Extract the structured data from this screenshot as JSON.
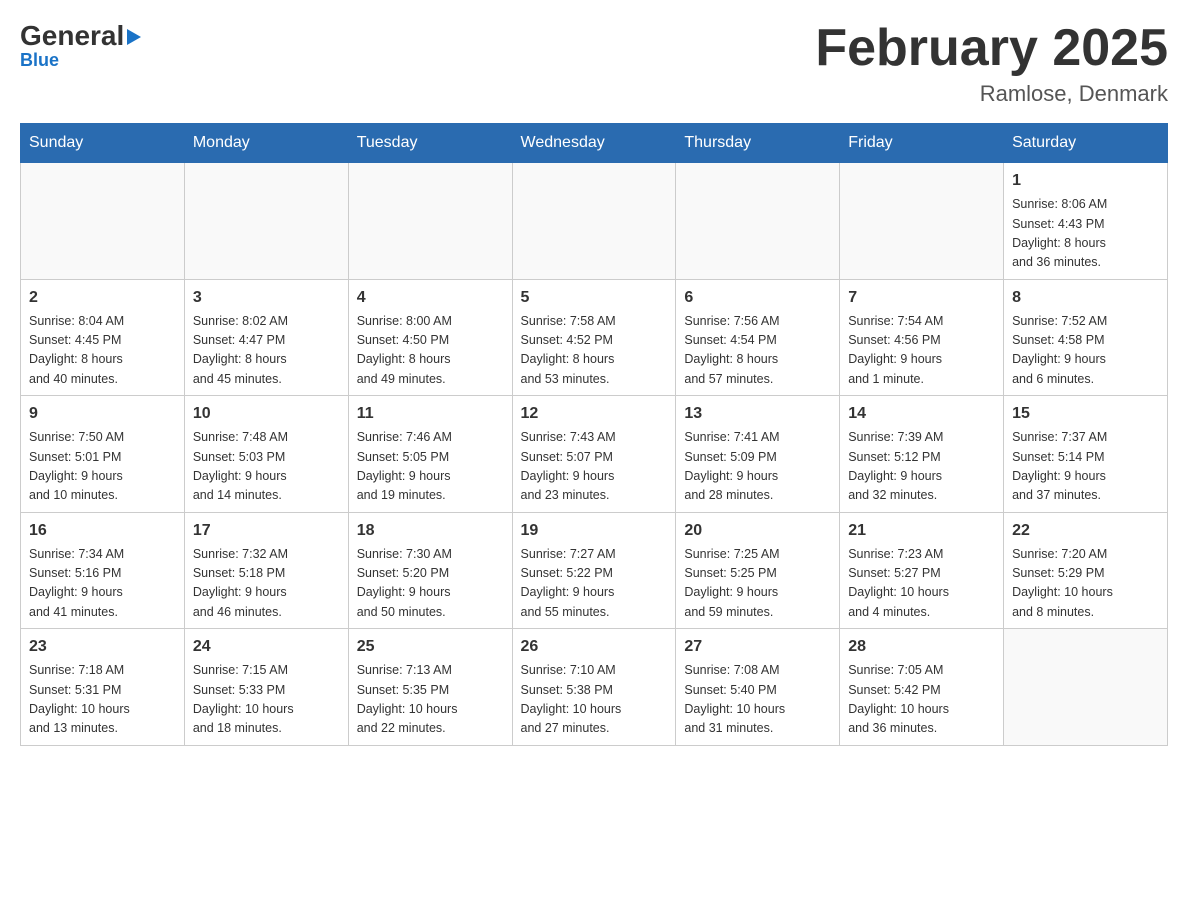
{
  "header": {
    "logo_general": "General",
    "logo_blue": "Blue",
    "title": "February 2025",
    "subtitle": "Ramlose, Denmark"
  },
  "weekdays": [
    "Sunday",
    "Monday",
    "Tuesday",
    "Wednesday",
    "Thursday",
    "Friday",
    "Saturday"
  ],
  "weeks": [
    [
      {
        "day": "",
        "info": ""
      },
      {
        "day": "",
        "info": ""
      },
      {
        "day": "",
        "info": ""
      },
      {
        "day": "",
        "info": ""
      },
      {
        "day": "",
        "info": ""
      },
      {
        "day": "",
        "info": ""
      },
      {
        "day": "1",
        "info": "Sunrise: 8:06 AM\nSunset: 4:43 PM\nDaylight: 8 hours\nand 36 minutes."
      }
    ],
    [
      {
        "day": "2",
        "info": "Sunrise: 8:04 AM\nSunset: 4:45 PM\nDaylight: 8 hours\nand 40 minutes."
      },
      {
        "day": "3",
        "info": "Sunrise: 8:02 AM\nSunset: 4:47 PM\nDaylight: 8 hours\nand 45 minutes."
      },
      {
        "day": "4",
        "info": "Sunrise: 8:00 AM\nSunset: 4:50 PM\nDaylight: 8 hours\nand 49 minutes."
      },
      {
        "day": "5",
        "info": "Sunrise: 7:58 AM\nSunset: 4:52 PM\nDaylight: 8 hours\nand 53 minutes."
      },
      {
        "day": "6",
        "info": "Sunrise: 7:56 AM\nSunset: 4:54 PM\nDaylight: 8 hours\nand 57 minutes."
      },
      {
        "day": "7",
        "info": "Sunrise: 7:54 AM\nSunset: 4:56 PM\nDaylight: 9 hours\nand 1 minute."
      },
      {
        "day": "8",
        "info": "Sunrise: 7:52 AM\nSunset: 4:58 PM\nDaylight: 9 hours\nand 6 minutes."
      }
    ],
    [
      {
        "day": "9",
        "info": "Sunrise: 7:50 AM\nSunset: 5:01 PM\nDaylight: 9 hours\nand 10 minutes."
      },
      {
        "day": "10",
        "info": "Sunrise: 7:48 AM\nSunset: 5:03 PM\nDaylight: 9 hours\nand 14 minutes."
      },
      {
        "day": "11",
        "info": "Sunrise: 7:46 AM\nSunset: 5:05 PM\nDaylight: 9 hours\nand 19 minutes."
      },
      {
        "day": "12",
        "info": "Sunrise: 7:43 AM\nSunset: 5:07 PM\nDaylight: 9 hours\nand 23 minutes."
      },
      {
        "day": "13",
        "info": "Sunrise: 7:41 AM\nSunset: 5:09 PM\nDaylight: 9 hours\nand 28 minutes."
      },
      {
        "day": "14",
        "info": "Sunrise: 7:39 AM\nSunset: 5:12 PM\nDaylight: 9 hours\nand 32 minutes."
      },
      {
        "day": "15",
        "info": "Sunrise: 7:37 AM\nSunset: 5:14 PM\nDaylight: 9 hours\nand 37 minutes."
      }
    ],
    [
      {
        "day": "16",
        "info": "Sunrise: 7:34 AM\nSunset: 5:16 PM\nDaylight: 9 hours\nand 41 minutes."
      },
      {
        "day": "17",
        "info": "Sunrise: 7:32 AM\nSunset: 5:18 PM\nDaylight: 9 hours\nand 46 minutes."
      },
      {
        "day": "18",
        "info": "Sunrise: 7:30 AM\nSunset: 5:20 PM\nDaylight: 9 hours\nand 50 minutes."
      },
      {
        "day": "19",
        "info": "Sunrise: 7:27 AM\nSunset: 5:22 PM\nDaylight: 9 hours\nand 55 minutes."
      },
      {
        "day": "20",
        "info": "Sunrise: 7:25 AM\nSunset: 5:25 PM\nDaylight: 9 hours\nand 59 minutes."
      },
      {
        "day": "21",
        "info": "Sunrise: 7:23 AM\nSunset: 5:27 PM\nDaylight: 10 hours\nand 4 minutes."
      },
      {
        "day": "22",
        "info": "Sunrise: 7:20 AM\nSunset: 5:29 PM\nDaylight: 10 hours\nand 8 minutes."
      }
    ],
    [
      {
        "day": "23",
        "info": "Sunrise: 7:18 AM\nSunset: 5:31 PM\nDaylight: 10 hours\nand 13 minutes."
      },
      {
        "day": "24",
        "info": "Sunrise: 7:15 AM\nSunset: 5:33 PM\nDaylight: 10 hours\nand 18 minutes."
      },
      {
        "day": "25",
        "info": "Sunrise: 7:13 AM\nSunset: 5:35 PM\nDaylight: 10 hours\nand 22 minutes."
      },
      {
        "day": "26",
        "info": "Sunrise: 7:10 AM\nSunset: 5:38 PM\nDaylight: 10 hours\nand 27 minutes."
      },
      {
        "day": "27",
        "info": "Sunrise: 7:08 AM\nSunset: 5:40 PM\nDaylight: 10 hours\nand 31 minutes."
      },
      {
        "day": "28",
        "info": "Sunrise: 7:05 AM\nSunset: 5:42 PM\nDaylight: 10 hours\nand 36 minutes."
      },
      {
        "day": "",
        "info": ""
      }
    ]
  ]
}
